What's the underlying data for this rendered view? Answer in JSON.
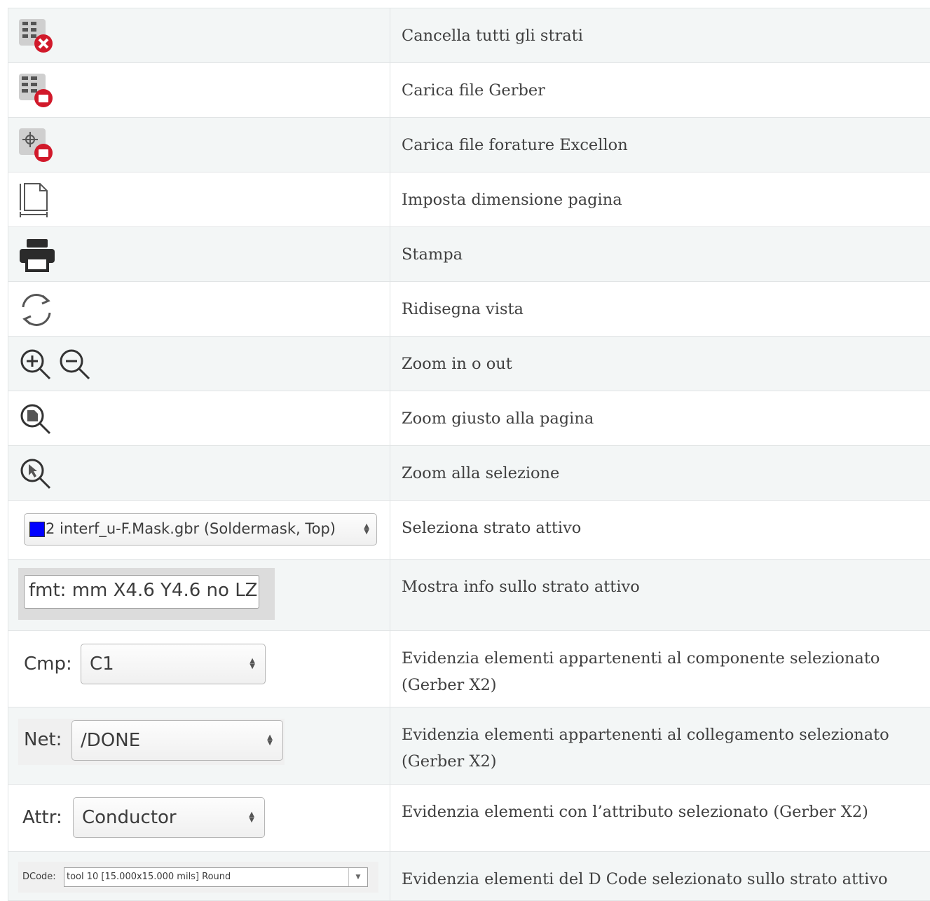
{
  "rows": [
    {
      "icon": "clear-all-layers-icon",
      "text": "Cancella tutti gli strati"
    },
    {
      "icon": "load-gerber-icon",
      "text": "Carica file Gerber"
    },
    {
      "icon": "load-excellon-icon",
      "text": "Carica file forature Excellon"
    },
    {
      "icon": "page-size-icon",
      "text": "Imposta dimensione pagina"
    },
    {
      "icon": "print-icon",
      "text": "Stampa"
    },
    {
      "icon": "redraw-icon",
      "text": "Ridisegna vista"
    },
    {
      "icon": "zoom-in-out-icon",
      "text": "Zoom in o out"
    },
    {
      "icon": "zoom-fit-page-icon",
      "text": "Zoom giusto alla pagina"
    },
    {
      "icon": "zoom-selection-icon",
      "text": "Zoom alla selezione"
    },
    {
      "text": "Seleziona strato attivo"
    },
    {
      "text": "Mostra info sullo strato attivo"
    },
    {
      "text": "Evidenzia elementi appartenenti al componente selezionato (Gerber X2)"
    },
    {
      "text": "Evidenzia elementi appartenenti al collegamento selezionato (Gerber X2)"
    },
    {
      "text": "Evidenzia elementi con l’attributo selezionato (Gerber X2)"
    },
    {
      "text": "Evidenzia elementi del D Code selezionato sullo strato attivo"
    }
  ],
  "layer_select": {
    "value": "2 interf_u-F.Mask.gbr (Soldermask, Top)",
    "swatch_color": "#0000ff"
  },
  "layer_info": {
    "value": "fmt: mm X4.6 Y4.6 no LZ"
  },
  "cmp": {
    "label": "Cmp:",
    "value": "C1"
  },
  "net": {
    "label": "Net:",
    "value": "/DONE"
  },
  "attr": {
    "label": "Attr:",
    "value": "Conductor"
  },
  "dcode": {
    "label": "DCode:",
    "value": "tool 10 [15.000x15.000 mils] Round"
  },
  "colors": {
    "icon_red": "#d1192a",
    "icon_gray": "#707070",
    "border": "#e1e4e5",
    "stripe": "#f3f6f6"
  }
}
